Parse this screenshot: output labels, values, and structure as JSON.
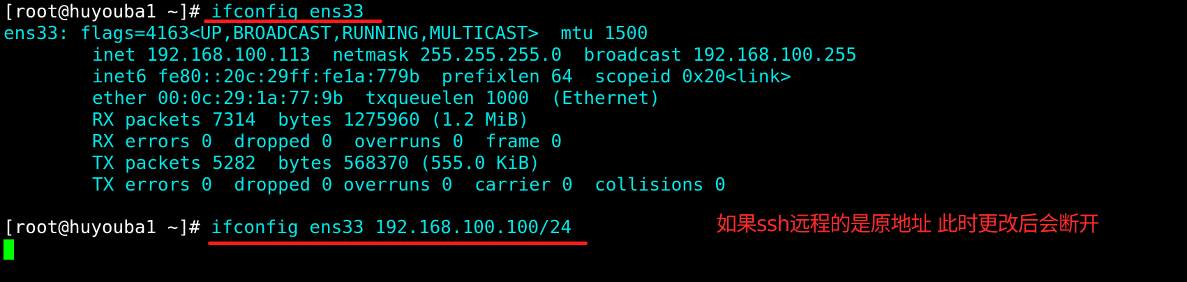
{
  "terminal": {
    "prompt1": "[root@huyouba1 ~]#",
    "cmd1": " ifconfig ens33",
    "output": [
      "ens33: flags=4163<UP,BROADCAST,RUNNING,MULTICAST>  mtu 1500",
      "inet 192.168.100.113  netmask 255.255.255.0  broadcast 192.168.100.255",
      "inet6 fe80::20c:29ff:fe1a:779b  prefixlen 64  scopeid 0x20<link>",
      "ether 00:0c:29:1a:77:9b  txqueuelen 1000  (Ethernet)",
      "RX packets 7314  bytes 1275960 (1.2 MiB)",
      "RX errors 0  dropped 0  overruns 0  frame 0",
      "TX packets 5282  bytes 568370 (555.0 KiB)",
      "TX errors 0  dropped 0 overruns 0  carrier 0  collisions 0"
    ],
    "prompt2": "[root@huyouba1 ~]#",
    "cmd2": " ifconfig ens33 192.168.100.100/24"
  },
  "annotation": {
    "text": "如果ssh远程的是原地址 此时更改后会断开"
  },
  "colors": {
    "background": "#000000",
    "command_text": "#00e5e5",
    "prompt_text": "#ffffff",
    "cursor": "#00ff00",
    "annotation": "#ff2a2a"
  }
}
